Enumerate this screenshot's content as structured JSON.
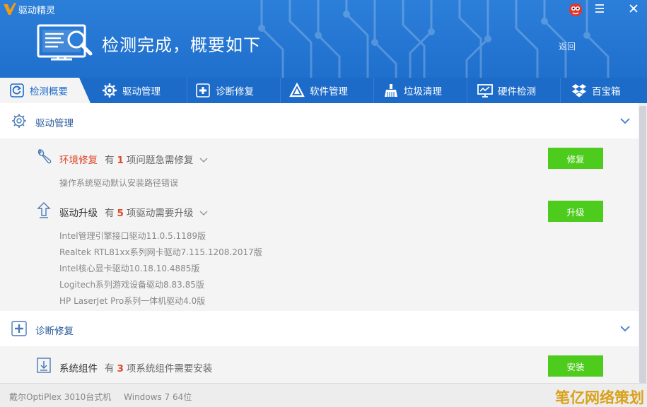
{
  "window": {
    "app_title": "驱动精灵",
    "minimize_icon": "menu-icon",
    "close_icon": "close-icon"
  },
  "header": {
    "headline": "检测完成，概要如下",
    "back_label": "返回"
  },
  "tabs": [
    {
      "label": "检测概要",
      "icon": "refresh-icon",
      "active": true
    },
    {
      "label": "驱动管理",
      "icon": "gear-icon",
      "active": false
    },
    {
      "label": "诊断修复",
      "icon": "medical-cross-icon",
      "active": false
    },
    {
      "label": "软件管理",
      "icon": "triangle-logo-icon",
      "active": false
    },
    {
      "label": "垃圾清理",
      "icon": "broom-icon",
      "active": false
    },
    {
      "label": "硬件检测",
      "icon": "monitor-chart-icon",
      "active": false
    },
    {
      "label": "百宝箱",
      "icon": "dropbox-icon",
      "active": false
    }
  ],
  "sections": {
    "driver_mgmt": {
      "title": "驱动管理",
      "env_repair": {
        "title": "环境修复",
        "prefix": "有",
        "count": "1",
        "suffix": "项问题急需修复",
        "detail": "操作系统驱动默认安装路径错误",
        "button": "修复"
      },
      "driver_upgrade": {
        "title": "驱动升级",
        "prefix": "有",
        "count": "5",
        "suffix": "项驱动需要升级",
        "button": "升级",
        "drivers": [
          "Intel管理引擎接口驱动11.0.5.1189版",
          "Realtek RTL81xx系列网卡驱动7.115.1208.2017版",
          "Intel核心显卡驱动10.18.10.4885版",
          "Logitech系列游戏设备驱动8.83.85版",
          "HP LaserJet Pro系列一体机驱动4.0版"
        ]
      }
    },
    "diagnose": {
      "title": "诊断修复",
      "components": {
        "title": "系统组件",
        "prefix": "有",
        "count": "3",
        "suffix": "项系统组件需要安装",
        "button": "安装"
      }
    }
  },
  "status": {
    "machine": "戴尔OptiPlex 3010台式机",
    "os": "Windows 7 64位",
    "watermark": "笔亿网络策划"
  },
  "colors": {
    "header_blue": "#2c7fd9",
    "tab_blue": "#1d6bc9",
    "accent_red": "#e0472a",
    "button_green": "#4ecc1e"
  }
}
